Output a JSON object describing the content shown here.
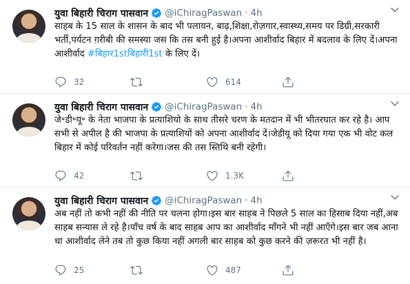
{
  "tweets": [
    {
      "name": "युवा बिहारी चिराग पासवान",
      "handle": "@iChiragPaswan",
      "dot": "·",
      "time": "4h",
      "text": "साहब के 15 साल के शासन के बाद भी पलायन, बाढ़,शिक्षा,रोज़गार,स्वास्थ्य,समय पर डिग्री,सरकारी भर्ती,पर्यटन ग़रीबी की समस्या जस कि तस बनी हुई है।अपना आशीर्वाद बिहार में बदलाव के लिए दें।अपना आशीर्वाद ",
      "hashtag": "#बिहार1stबिहारी1st",
      "text_end": " के लिए दें।",
      "replies": "32",
      "retweets": "",
      "likes": "614"
    },
    {
      "name": "युवा बिहारी चिराग पासवान",
      "handle": "@iChiragPaswan",
      "dot": "·",
      "time": "4h",
      "text": "जे॰डी॰यू॰ के नेता भाजपा के प्रत्याशियो के साथ तीसरे चरण के मतदान में भी भीतरघात कर रहे है। आप सभी से अपील है की भाजपा के प्रत्याशियों को अपना आशीर्वाद दें।जेडीयू को दिया गया एक भी वोट कल बिहार में कोई परिवर्तन नहीं करेगा।जस की तस स्तिथि बनी रहेगी।",
      "hashtag": "",
      "text_end": "",
      "replies": "42",
      "retweets": "",
      "likes": "1.3K"
    },
    {
      "name": "युवा बिहारी चिराग पासवान",
      "handle": "@iChiragPaswan",
      "dot": "·",
      "time": "4h",
      "text": "अब नहीं तो कभी नहीं की नीति पर चलना होगा।इस बार साहब ने पिछले 5 साल का हिसाब दिया नहीं,अब साहब सन्यास ले रहे है।पाँच वर्ष के बाद साहब आप का आशीर्वाद माँगने भी नहीं आएँगे।इस बार जब आना था आशीर्वाद लेने तब तो कुछ किया नहीं अगली बार साहब को कुछ करने की ज़रूरत भी नहीं है।",
      "hashtag": "",
      "text_end": "",
      "replies": "25",
      "retweets": "",
      "likes": "487"
    }
  ],
  "icons": {
    "verified": "verified-badge-icon",
    "more": "chevron-down-icon",
    "reply": "reply-icon",
    "retweet": "retweet-icon",
    "like": "heart-icon",
    "share": "share-icon"
  },
  "colors": {
    "accent": "#1d9bf0",
    "muted": "#5b7083",
    "divider": "#e6ecf0",
    "text": "#0f1419"
  }
}
